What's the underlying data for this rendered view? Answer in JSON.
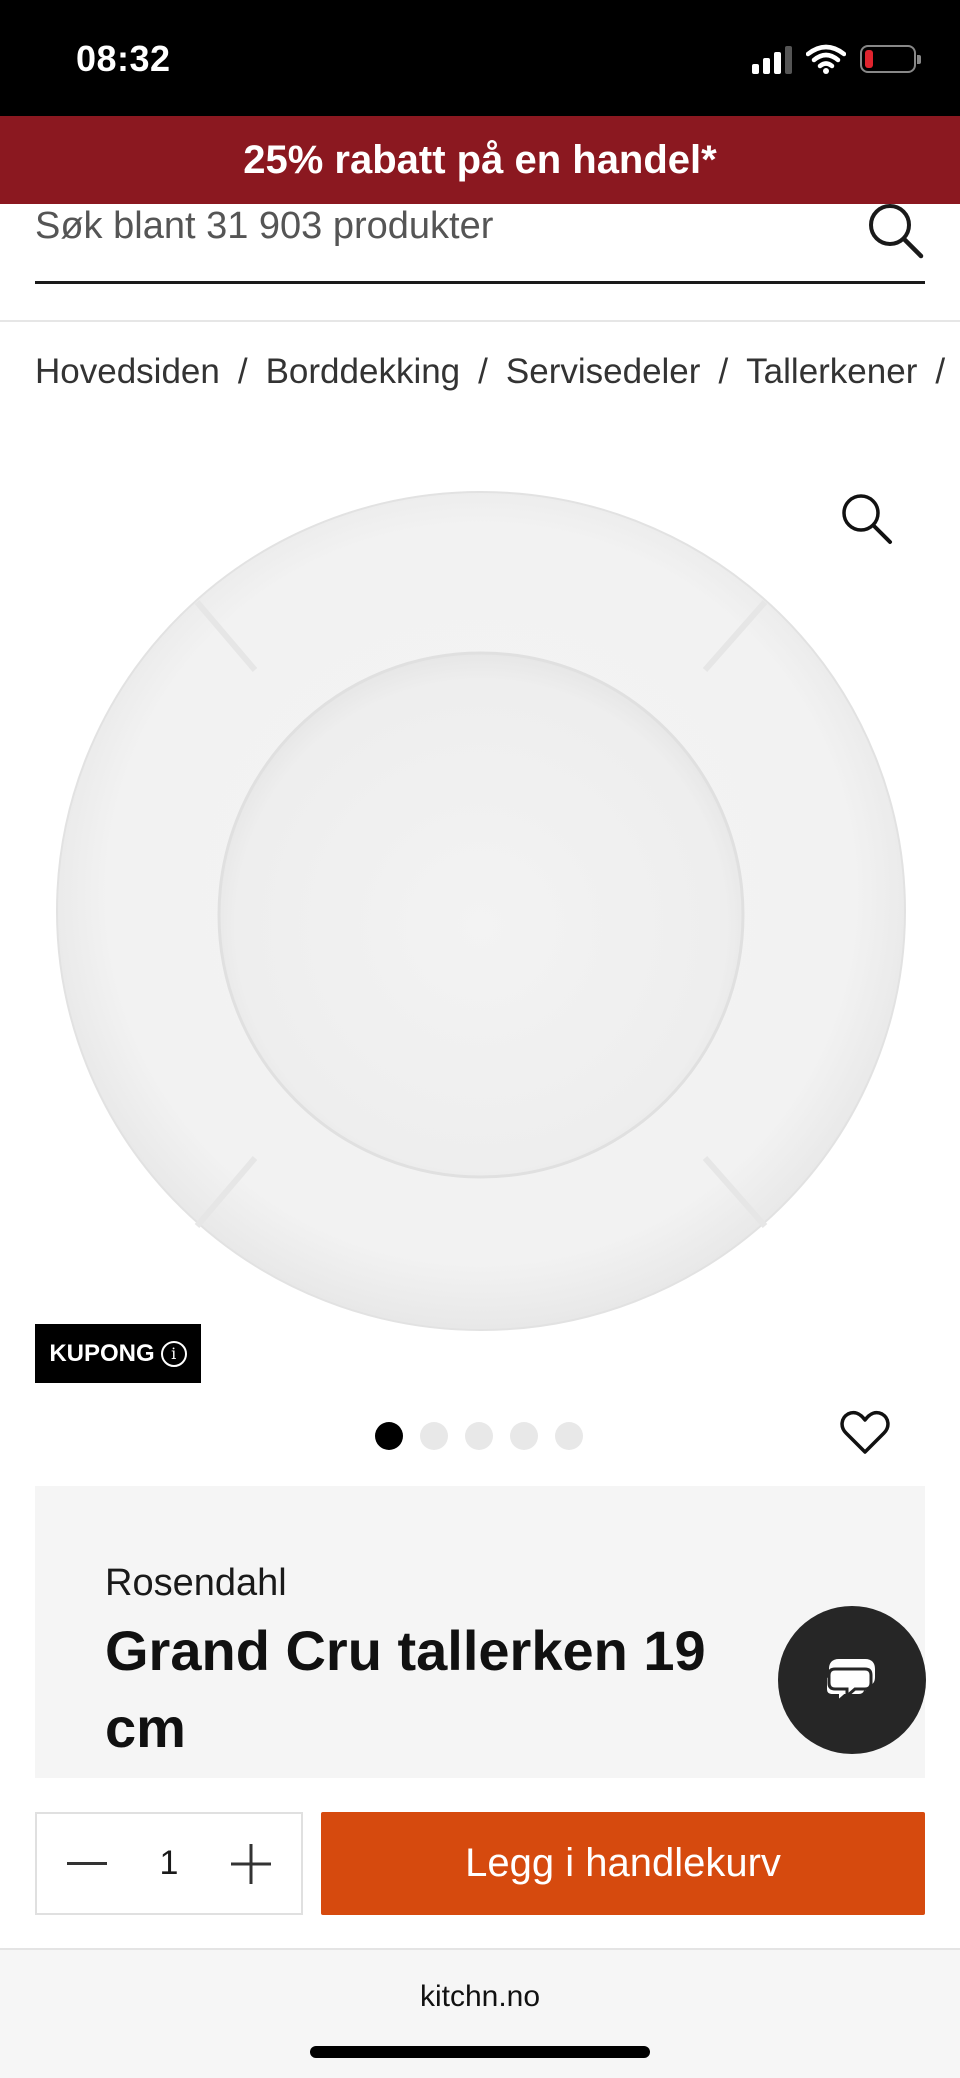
{
  "status_bar": {
    "time": "08:32"
  },
  "promo": {
    "text": "25% rabatt på en handel*"
  },
  "search": {
    "placeholder": "Søk blant 31 903 produkter"
  },
  "breadcrumb": {
    "items": [
      "Hovedsiden",
      "Borddekking",
      "Servisedeler",
      "Tallerkener"
    ],
    "separator": "/"
  },
  "product": {
    "coupon_label": "KUPONG",
    "info_glyph": "i",
    "brand": "Rosendahl",
    "title": "Grand Cru tallerken 19 cm",
    "image_count": 5,
    "active_image_index": 0
  },
  "cart": {
    "quantity": "1",
    "add_label": "Legg i handlekurv"
  },
  "browser": {
    "url": "kitchn.no"
  },
  "colors": {
    "promo_bg": "#8b1820",
    "add_to_cart_bg": "#d64a0e",
    "chat_bg": "#262626"
  },
  "icons": {
    "search": "search-icon",
    "zoom": "zoom-icon",
    "heart": "heart-icon",
    "chat": "chat-icon",
    "minus": "minus-icon",
    "plus": "plus-icon"
  }
}
